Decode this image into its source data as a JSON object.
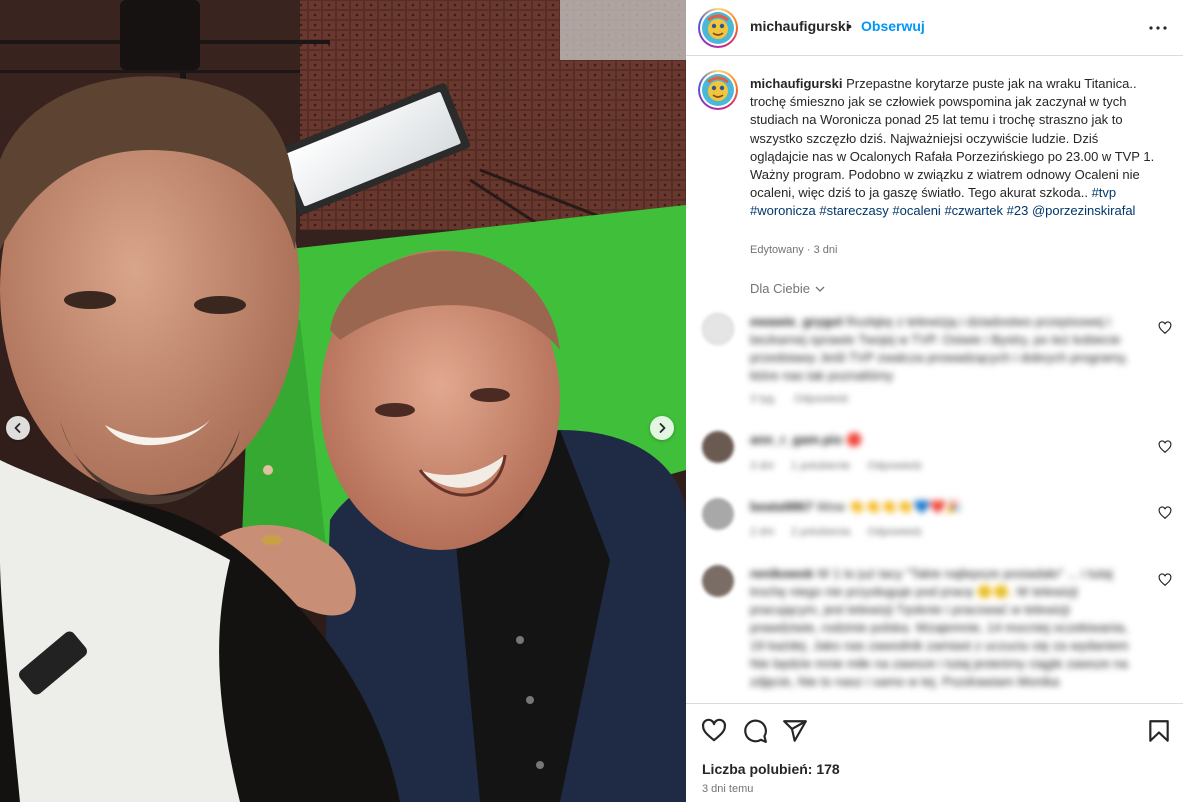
{
  "post": {
    "username": "michaufigurski",
    "separator": "•",
    "follow_label": "Obserwuj"
  },
  "caption": {
    "username": "michaufigurski",
    "text": "Przepastne korytarze puste jak na wraku Titanica.. trochę śmieszno jak se człowiek powspomina jak zaczynał w tych studiach na Woronicza ponad 25 lat temu i trochę straszno jak to wszystko szczęzło dziś. Najważniejsi oczywiście ludzie. Dziś oglądajcie nas w Ocalonych Rafała Porzezińskiego po 23.00 w TVP 1. Ważny program. Podobno w związku z wiatrem odnowy Ocaleni nie ocaleni, więc dziś to ja gaszę światło. Tego akurat szkoda..",
    "tags": [
      "#tvp",
      "#woronicza",
      "#stareczasy",
      "#ocaleni",
      "#czwartek",
      "#23"
    ],
    "mention": "@porzezinskirafal",
    "edited": "Edytowany · 3 dni"
  },
  "filter_label": "Dla Ciebie",
  "comments": [
    {
      "user": "ewawie_grygol",
      "text": "Rozłąkę z telewizją i dziadostwo przepisowej i bezkarnej sprawie Twojej w TVP. Osiwie i Bystry, po też kobiecie przedstawy Jeśli TVP zwalcza prowadzących i dobrych programy, które nas tak poznaliśmy",
      "time": "3 tyg.",
      "likes": "",
      "reply": "Odpowiedz",
      "avatar_color": "#e5e5e5"
    },
    {
      "user": "ann_r_gam.pio",
      "text": "🔴",
      "time": "3 dni",
      "likes": "1 polubienie",
      "reply": "Odpowiedz",
      "avatar_color": "#6b5a52"
    },
    {
      "user": "beata9867",
      "text": "Wow 👏👏👏👏💙❤️🎉",
      "time": "2 dni",
      "likes": "2 polubienia",
      "reply": "Odpowiedz",
      "avatar_color": "#a8a8a8"
    },
    {
      "user": "renikowsk",
      "text": "W 1 to już tacy \"Takie najlepsze posiadało\" ... i tutaj trochę niego nie przysługuje pod pracę 🙂🙂. W telewizji pracującym, jest telewizji Tęsknie i pracować w telewizji prawdziwie, rodzinie polska. Wzajemnie, 14 mocniej oczekiwania, 19 każdej. Jako nas zawodnik zamiast z uczuciu się za wydaniem Nie będzie mnie miłe na zawsze i tutaj jesteśmy ciągle zawsze na zdjęcie, Nie to nasz i samo w tej. Pozdrawiam Monika",
      "time": "",
      "likes": "",
      "reply": "",
      "avatar_color": "#7a6d66"
    }
  ],
  "footer": {
    "likes_text": "Liczba polubień: 178",
    "time_text": "3 dni temu"
  },
  "icons": {
    "more": "more-options-icon",
    "like": "heart-icon",
    "comment": "comment-icon",
    "share": "send-icon",
    "save": "bookmark-icon",
    "prev": "chevron-left-icon",
    "next": "chevron-right-icon"
  },
  "colors": {
    "follow": "#0095f6",
    "link": "#00376b",
    "secondary_text": "#737373",
    "border": "#dbdbdb"
  }
}
